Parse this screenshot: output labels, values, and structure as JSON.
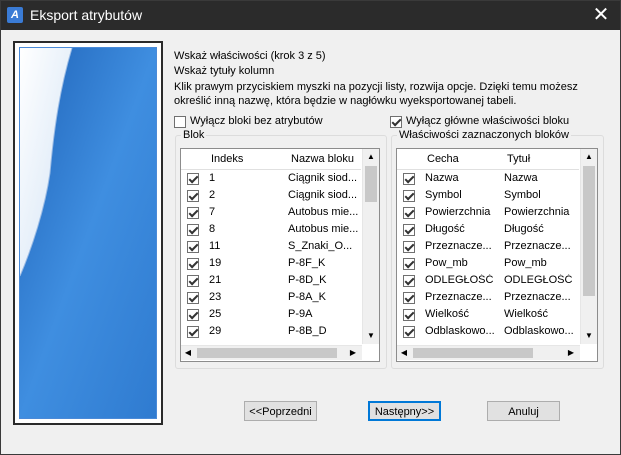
{
  "window": {
    "title": "Eksport atrybutów"
  },
  "instructions": {
    "line1": "Wskaż właściwości (krok 3 z 5)",
    "line2": "Wskaż tytuły kolumn",
    "line3": "Klik prawym przyciskiem myszki na pozycji listy, rozwija opcje. Dzięki temu możesz",
    "line4": "określić inną nazwę, która będzie w nagłówku wyeksportowanej tabeli."
  },
  "options": {
    "exclude_blocks_label": "Wyłącz bloki bez atrybutów",
    "exclude_blocks_checked": false,
    "exclude_main_props_label": "Wyłącz główne właściwości bloku",
    "exclude_main_props_checked": true
  },
  "blocks": {
    "group_label": "Blok",
    "columns": [
      "Indeks",
      "Nazwa bloku"
    ],
    "rows": [
      {
        "index": "1",
        "name": "Ciągnik siod...",
        "checked": true
      },
      {
        "index": "2",
        "name": "Ciągnik siod...",
        "checked": true
      },
      {
        "index": "7",
        "name": "Autobus mie...",
        "checked": true
      },
      {
        "index": "8",
        "name": "Autobus mie...",
        "checked": true
      },
      {
        "index": "11",
        "name": "S_Znaki_O...",
        "checked": true
      },
      {
        "index": "19",
        "name": "P-8F_K",
        "checked": true
      },
      {
        "index": "21",
        "name": "P-8D_K",
        "checked": true
      },
      {
        "index": "23",
        "name": "P-8A_K",
        "checked": true
      },
      {
        "index": "25",
        "name": "P-9A",
        "checked": true
      },
      {
        "index": "29",
        "name": "P-8B_D",
        "checked": true
      }
    ]
  },
  "properties": {
    "group_label": "Właściwości zaznaczonych bloków",
    "columns": [
      "Cecha",
      "Tytuł"
    ],
    "rows": [
      {
        "feature": "Nazwa",
        "title": "Nazwa",
        "checked": true
      },
      {
        "feature": "Symbol",
        "title": "Symbol",
        "checked": true
      },
      {
        "feature": "Powierzchnia",
        "title": "Powierzchnia",
        "checked": true
      },
      {
        "feature": "Długość",
        "title": "Długość",
        "checked": true
      },
      {
        "feature": "Przeznacze...",
        "title": "Przeznacze...",
        "checked": true
      },
      {
        "feature": "Pow_mb",
        "title": "Pow_mb",
        "checked": true
      },
      {
        "feature": "ODLEGŁOŚĆ",
        "title": "ODLEGŁOŚĆ",
        "checked": true
      },
      {
        "feature": "Przeznacze...",
        "title": "Przeznacze...",
        "checked": true
      },
      {
        "feature": "Wielkość",
        "title": "Wielkość",
        "checked": true
      },
      {
        "feature": "Odblaskowo...",
        "title": "Odblaskowo...",
        "checked": true
      }
    ]
  },
  "buttons": {
    "prev": "<<Poprzedni",
    "next": "Następny>>",
    "cancel": "Anuluj"
  },
  "colors": {
    "titlebar": "#2b2b2b",
    "accent": "#0078d7",
    "page_blue": "#2f7bd0"
  }
}
